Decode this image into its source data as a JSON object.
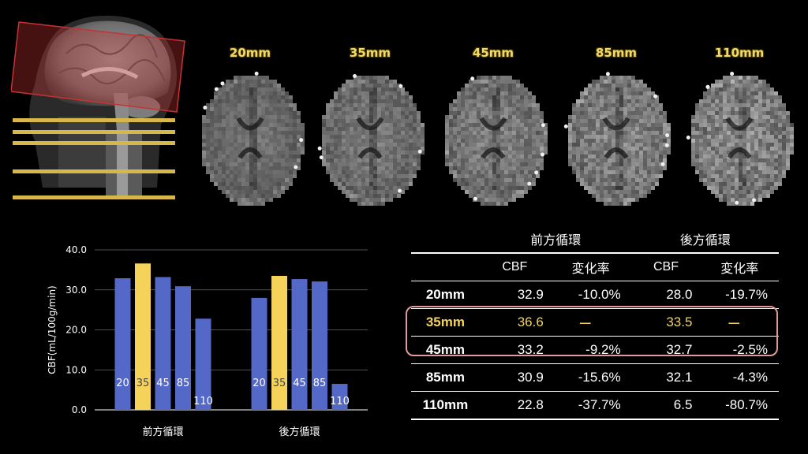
{
  "slice_labels": [
    "20mm",
    "35mm",
    "45mm",
    "85mm",
    "110mm"
  ],
  "colors": {
    "background": "#000000",
    "bar_default": "#5468c8",
    "bar_highlight": "#f5d25a",
    "label_gold": "#f2da6a",
    "highlight_border": "#e59a9a",
    "slab_red": "#c83232",
    "slice_line_gold": "#d6b84a"
  },
  "chart_data": {
    "type": "bar",
    "categories": [
      "前方循環",
      "後方循環"
    ],
    "bar_labels": [
      "20",
      "35",
      "45",
      "85",
      "110"
    ],
    "highlight_bar": "35",
    "series": [
      {
        "values": [
          32.9,
          36.6,
          33.2,
          30.9,
          22.8
        ]
      },
      {
        "values": [
          28.0,
          33.5,
          32.7,
          32.1,
          6.5
        ]
      }
    ],
    "ylabel": "CBF(mL/100g/min)",
    "ylim": [
      0,
      40
    ],
    "yticks": [
      "0.0",
      "10.0",
      "20.0",
      "30.0",
      "40.0"
    ],
    "grid": true
  },
  "table": {
    "group_headers": [
      "前方循環",
      "後方循環"
    ],
    "sub_headers": [
      "CBF",
      "変化率",
      "CBF",
      "変化率"
    ],
    "rows": [
      {
        "label": "20mm",
        "a_cbf": "32.9",
        "a_change": "-10.0%",
        "p_cbf": "28.0",
        "p_change": "-19.7%"
      },
      {
        "label": "35mm",
        "a_cbf": "36.6",
        "a_change": "ー",
        "p_cbf": "33.5",
        "p_change": "ー"
      },
      {
        "label": "45mm",
        "a_cbf": "33.2",
        "a_change": "-9.2%",
        "p_cbf": "32.7",
        "p_change": "-2.5%"
      },
      {
        "label": "85mm",
        "a_cbf": "30.9",
        "a_change": "-15.6%",
        "p_cbf": "32.1",
        "p_change": "-4.3%"
      },
      {
        "label": "110mm",
        "a_cbf": "22.8",
        "a_change": "-37.7%",
        "p_cbf": "6.5",
        "p_change": "-80.7%"
      }
    ]
  }
}
